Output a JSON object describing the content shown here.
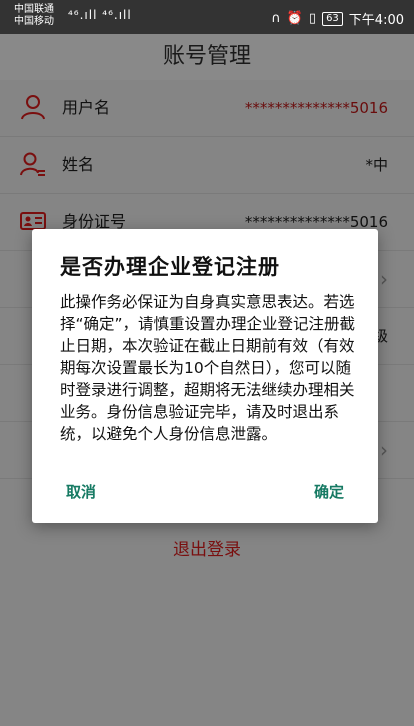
{
  "status": {
    "carrier1": "中国联通",
    "carrier2": "中国移动",
    "signal": "⁴⁶.ıll ⁴⁶.ıll",
    "battery": "63",
    "time": "下午4:00"
  },
  "header": {
    "title": "账号管理"
  },
  "rows": [
    {
      "label": "用户名",
      "value": "**************5016",
      "icon": "user-icon"
    },
    {
      "label": "姓名",
      "value": "*中",
      "icon": "user-card-icon"
    },
    {
      "label": "身份证号",
      "value": "**************5016",
      "icon": "id-card-icon"
    }
  ],
  "hidden_rows": {
    "row4_suffix": "级"
  },
  "logout_label": "退出登录",
  "dialog": {
    "title": "是否办理企业登记注册",
    "message": "此操作务必保证为自身真实意思表达。若选择“确定”，请慎重设置办理企业登记注册截止日期，本次验证在截止日期前有效（有效期每次设置最长为10个自然日），您可以随时登录进行调整，超期将无法继续办理相关业务。身份信息验证完毕，请及时退出系统，以避免个人身份信息泄露。",
    "cancel": "取消",
    "confirm": "确定"
  },
  "colors": {
    "accent": "#7a0f0f",
    "button": "#167a63"
  }
}
